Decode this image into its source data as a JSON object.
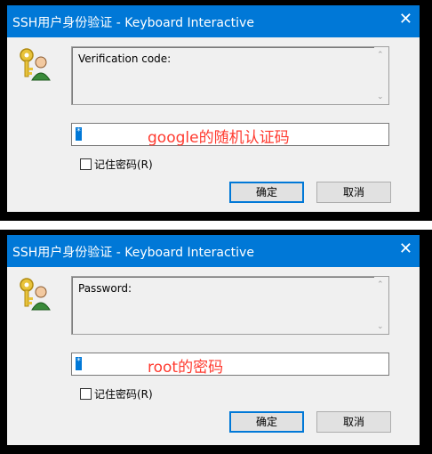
{
  "dialogs": [
    {
      "title": "SSH用户身份验证 - Keyboard Interactive",
      "close_glyph": "✕",
      "prompt_text": "Verification code:",
      "input_value": "*",
      "annotation": "google的随机认证码",
      "remember_label": "记住密码(R)",
      "ok_label": "确定",
      "cancel_label": "取消",
      "scroll_up": "⌃",
      "scroll_down": "⌄"
    },
    {
      "title": "SSH用户身份验证 - Keyboard Interactive",
      "close_glyph": "✕",
      "prompt_text": "Password:",
      "input_value": "*",
      "annotation": "root的密码",
      "remember_label": "记住密码(R)",
      "ok_label": "确定",
      "cancel_label": "取消",
      "scroll_up": "⌃",
      "scroll_down": "⌄"
    }
  ],
  "colors": {
    "titlebar": "#0078d7",
    "annotation": "#ff3b30",
    "key_icon": "#e8c33a",
    "user_icon": "#3a8a3a"
  },
  "icons": {
    "dialog_icon": "key-user-icon",
    "close": "close-icon"
  }
}
